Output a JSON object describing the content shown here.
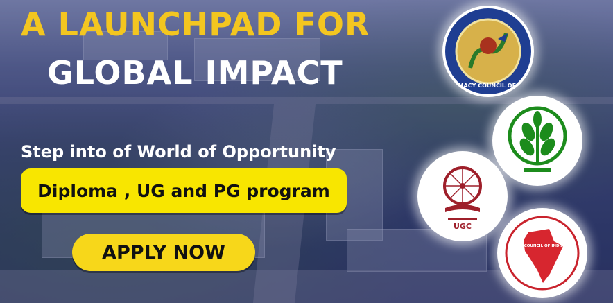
{
  "banner": {
    "title_line1": "A LAUNCHPAD FOR",
    "title_line2": "GLOBAL IMPACT",
    "tagline": "Step into of World of Opportunity",
    "programs_label": "Diploma , UG and PG program",
    "apply_label": "APPLY NOW"
  },
  "logos": {
    "pharmacy": {
      "icon": "pharmacy-council-logo",
      "text": "PHARMACY COUNCIL OF INDIA"
    },
    "agriculture": {
      "icon": "icar-agriculture-logo"
    },
    "ugc": {
      "icon": "ugc-logo",
      "text": "UGC"
    },
    "bar": {
      "icon": "bar-council-logo",
      "text": "BAR COUNCIL OF INDIA"
    }
  },
  "colors": {
    "title_yellow": "#f3c620",
    "button_yellow": "#f8e600",
    "overlay_navy": "#2f3a63"
  }
}
